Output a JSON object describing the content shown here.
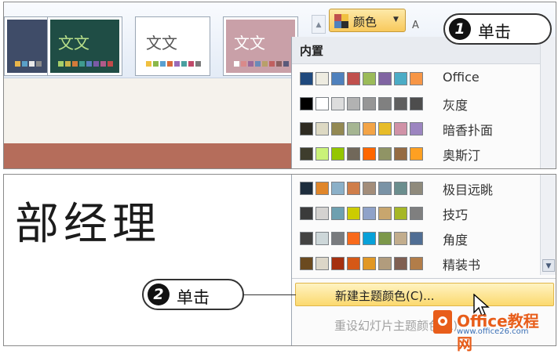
{
  "ribbon": {
    "colors_button_label": "颜色",
    "peek_text": "A"
  },
  "themes": [
    {
      "title": "",
      "bg": "#3f4c68",
      "fg": "#ffffff",
      "swatches": [
        "#e8b54a",
        "#5aa0c8",
        "#e8e8e8",
        "#8a8a8a"
      ]
    },
    {
      "title": "文文",
      "bg": "#1f4d45",
      "fg": "#b9e08a",
      "swatches": [
        "#a6cf6a",
        "#c9b34a",
        "#d27a3a",
        "#3f9b8f",
        "#5a7fc0",
        "#7a5aa6",
        "#b05a8a",
        "#c04a4a"
      ]
    },
    {
      "title": "文文",
      "bg": "#ffffff",
      "fg": "#555555",
      "swatches": [
        "#f0c040",
        "#8bb84a",
        "#5a9fd0",
        "#d96a3a",
        "#9a6ab8",
        "#4aa0a0",
        "#c04a6a",
        "#7a7a7a"
      ]
    },
    {
      "title": "文文",
      "bg": "#c9a0a8",
      "fg": "#ffffff",
      "swatches": [
        "#ffffff",
        "#d98a8a",
        "#9a6a9a",
        "#6a8ab8",
        "#b8a06a",
        "#c06060",
        "#8a6060",
        "#5a5a7a"
      ]
    }
  ],
  "dropdown": {
    "section_label": "内置",
    "palettes_top": [
      {
        "name": "Office",
        "colors": [
          "#1f497d",
          "#eeece1",
          "#4f81bd",
          "#c0504d",
          "#9bbb59",
          "#8064a2",
          "#4bacc6",
          "#f79646"
        ]
      },
      {
        "name": "灰度",
        "colors": [
          "#000000",
          "#ffffff",
          "#dddddd",
          "#b2b2b2",
          "#969696",
          "#808080",
          "#5f5f5f",
          "#4d4d4d"
        ]
      },
      {
        "name": "暗香扑面",
        "colors": [
          "#2e2b21",
          "#ddd9c3",
          "#938953",
          "#a5b592",
          "#f3a447",
          "#e7bc29",
          "#d092a7",
          "#9c85c0"
        ]
      },
      {
        "name": "奥斯汀",
        "colors": [
          "#3e3d2d",
          "#caf278",
          "#94c600",
          "#71685a",
          "#ff6700",
          "#909465",
          "#956b43",
          "#fea022"
        ]
      }
    ],
    "palettes_bottom": [
      {
        "name": "极目远眺",
        "colors": [
          "#1d2d3d",
          "#e0862a",
          "#8bb0c8",
          "#cf7e4a",
          "#a38d7a",
          "#7a93a6",
          "#6b8e8e",
          "#8f8a7c"
        ]
      },
      {
        "name": "技巧",
        "colors": [
          "#3b3b3b",
          "#d4d2d0",
          "#6ea0b0",
          "#cccc00",
          "#8fa2c9",
          "#c8a66e",
          "#a6b727",
          "#7f7f7f"
        ]
      },
      {
        "name": "角度",
        "colors": [
          "#434342",
          "#cdd7d9",
          "#797b7e",
          "#f96a1b",
          "#08a1d9",
          "#7c984a",
          "#c2ad8d",
          "#506e94"
        ]
      },
      {
        "name": "精装书",
        "colors": [
          "#6b4a1f",
          "#dcd6c8",
          "#a5300f",
          "#d55816",
          "#e19825",
          "#b19c7d",
          "#7f5f52",
          "#b27d49"
        ]
      }
    ],
    "new_colors_item": "新建主题颜色(C)...",
    "reset_item": "重设幻灯片主题颜色(R)"
  },
  "slide": {
    "title_text": "部经理"
  },
  "callouts": [
    {
      "number": "1",
      "text": "单击"
    },
    {
      "number": "2",
      "text": "单击"
    }
  ],
  "watermark": {
    "title": "Office教程网",
    "subtitle": "www.office26.com"
  }
}
